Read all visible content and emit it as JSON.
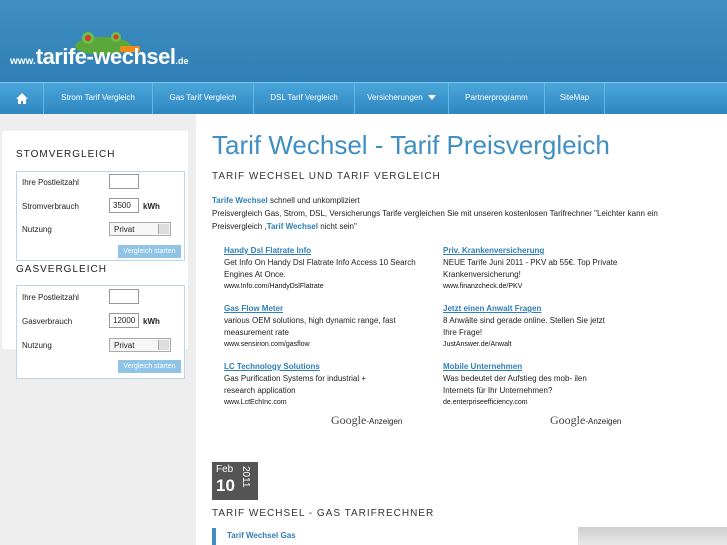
{
  "logo": {
    "www": "www.",
    "main": "tarife-wechsel",
    "tld": ".de"
  },
  "nav": {
    "items": [
      "Strom Tarif Vergleich",
      "Gas Tarif Vergleich",
      "DSL Tarif Vergleich",
      "Versicherungen",
      "Partnerprogramm",
      "SiteMap"
    ]
  },
  "sidebar": {
    "strom": {
      "title": "STOMVERGLEICH",
      "plz_label": "Ihre Postleitzahl",
      "verbrauch_label": "Stromverbrauch",
      "verbrauch_value": "3500",
      "unit": "kWh",
      "nutzung_label": "Nutzung",
      "nutzung_value": "Privat",
      "button": "Vergleich starten"
    },
    "gas": {
      "title": "GASVERGLEICH",
      "plz_label": "Ihre Postleitzahl",
      "verbrauch_label": "Gasverbrauch",
      "verbrauch_value": "12000",
      "unit": "kWh",
      "nutzung_label": "Nutzung",
      "nutzung_value": "Privat",
      "button": "Vergleich starten"
    }
  },
  "main": {
    "title": "Tarif Wechsel - Tarif Preisvergleich",
    "subtitle": "TARIF WECHSEL UND TARIF VERGLEICH",
    "intro_link1": "Tarife Wechsel",
    "intro_text1": " schnell und unkompliziert",
    "intro_text2": "Preisvergleich Gas, Strom, DSL, Versicherungs Tarife vergleichen Sie mit unseren kostenlosen Tarifrechner \"Leichter kann ein Preisvergleich ,",
    "intro_link2": "Tarif Wechsel",
    "intro_text3": " nicht sein\""
  },
  "ads_left": [
    {
      "title": "Handy Dsl Flatrate Info",
      "desc": "Get Info On Handy Dsl Flatrate Info Access 10 Search Engines At Once.",
      "url": "www.Info.com/HandyDslFlatrate"
    },
    {
      "title": "Gas Flow Meter",
      "desc": "various OEM solutions, high dynamic range, fast measurement rate",
      "url": "www.sensirion.com/gasflow"
    },
    {
      "title": "LC Technology Solutions",
      "desc": "Gas Purification Systems for industrial + research application",
      "url": "www.LctEchInc.com"
    }
  ],
  "ads_right": [
    {
      "title": "Priv. Krankenversicherung",
      "desc": "NEUE Tarife Juni 2011 - PKV ab 55€. Top Private Krankenversicherung!",
      "url": "www.finanzcheck.de/PKV"
    },
    {
      "title": "Jetzt einen Anwalt Fragen",
      "desc": "8 Anwälte sind gerade online. Stellen Sie jetzt Ihre Frage!",
      "url": "JustAnswer.de/Anwalt"
    },
    {
      "title": "Mobile Unternehmen",
      "desc": "Was bedeutet der Aufstieg des mob- ilen Internets für Ihr Unternehmen?",
      "url": "de.enterpriseefficiency.com"
    }
  ],
  "google_ads": {
    "brand": "Google",
    "suffix": "-Anzeigen"
  },
  "post": {
    "month": "Feb",
    "day": "10",
    "year": "2011",
    "title": "TARIF WECHSEL - GAS TARIFRECHNER",
    "item": "Tarif Wechsel Gas"
  },
  "colors": {
    "brand": "#3f8fc2",
    "nav": "#2e86bf",
    "link": "#2f7fb6"
  }
}
